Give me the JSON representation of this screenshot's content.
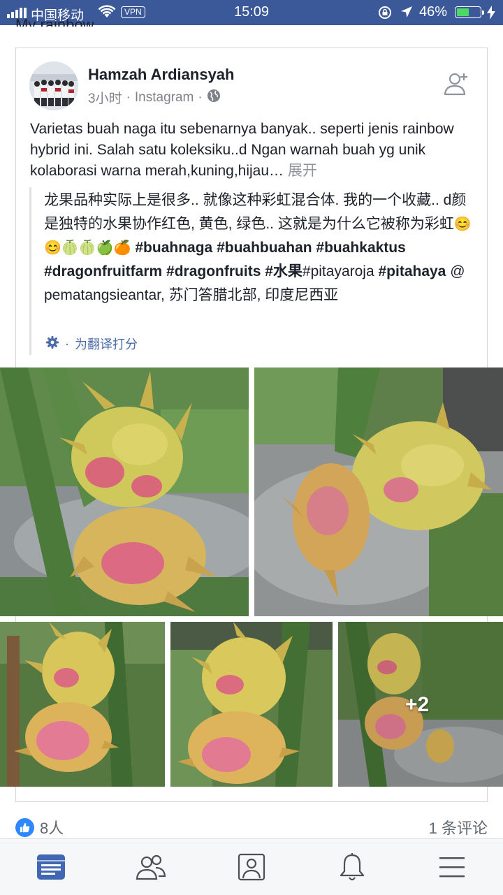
{
  "status_bar": {
    "carrier": "中国移动",
    "vpn": "VPN",
    "time": "15:09",
    "battery_percent": "46%",
    "battery_level": 0.46
  },
  "previous_post_title": "My rainbow",
  "post": {
    "author": "Hamzah Ardiansyah",
    "time": "3小时",
    "source": "Instagram",
    "separator": "·",
    "text_main": "Varietas buah naga itu sebenarnya banyak.. seperti jenis rainbow hybrid ini. Salah satu koleksiku..d Ngan warnah buah yg unik kolaborasi warna merah,kuning,hijau…",
    "see_more": "展开",
    "translation_plain": "龙果品种实际上是很多.. 就像这种彩虹混合体. 我的一个收藏.. d颜是独特的水果协作红色, 黄色, 绿色.. 这就是为什么它被称为彩虹",
    "translation_emoji": "😊😊🍈🍈🍏🍊",
    "translation_tags": [
      {
        "text": "#buahnaga",
        "bold": true
      },
      {
        "text": "#buahbuahan",
        "bold": true
      },
      {
        "text": "#buahkaktus",
        "bold": true
      },
      {
        "text": "#dragonfruitfarm",
        "bold": true
      },
      {
        "text": "#dragonfruits",
        "bold": true
      },
      {
        "text": "#水果",
        "bold": true
      },
      {
        "text": "#pitayaroja",
        "bold": false
      },
      {
        "text": "#pitahaya",
        "bold": true
      }
    ],
    "translation_tail": "@ pematangsieantar, 苏门答腊北部, 印度尼西亚",
    "rate_translation": "为翻译打分",
    "rate_separator": "·",
    "extra_photos": "+2",
    "likes": "8人",
    "comments": "1 条评论"
  },
  "icons": {
    "globe": "globe-icon",
    "add_friend": "add-friend-icon",
    "settings": "gear-icon",
    "like": "thumbs-up-icon",
    "tabs": [
      "news-feed-icon",
      "friends-icon",
      "profile-icon",
      "notifications-icon",
      "menu-icon"
    ]
  },
  "colors": {
    "brand": "#3b5998",
    "link": "#4b6aa8",
    "active_tab": "#4267b2",
    "inactive_tab": "#4b4f56",
    "like": "#2d88ff"
  }
}
